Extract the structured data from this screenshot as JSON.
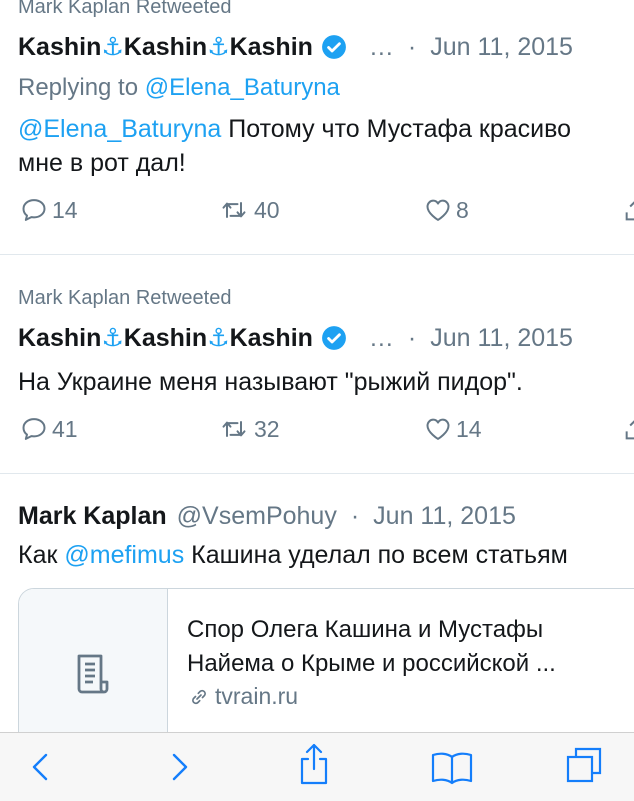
{
  "tweets": [
    {
      "retweeted_by": "Mark Kaplan Retweeted",
      "name_part1": "Kashin",
      "name_part2": "Kashin",
      "name_part3": "Kashin",
      "anchor_glyph": "⚓",
      "more": "…",
      "sep": "·",
      "date": "Jun 11, 2015",
      "replying_label": "Replying to",
      "replying_handle": "@Elena_Baturyna",
      "text_mention": "@Elena_Baturyna",
      "text": " Потому что Мустафа красиво мне в рот дал!",
      "replies": "14",
      "retweets": "40",
      "likes": "8"
    },
    {
      "retweeted_by": "Mark Kaplan Retweeted",
      "name_part1": "Kashin",
      "name_part2": "Kashin",
      "name_part3": "Kashin",
      "anchor_glyph": "⚓",
      "more": "…",
      "sep": "·",
      "date": "Jun 11, 2015",
      "text": "На Украине меня называют \"рыжий пидор\".",
      "replies": "41",
      "retweets": "32",
      "likes": "14"
    },
    {
      "name": "Mark Kaplan",
      "handle": "@VsemPohuy",
      "sep": "·",
      "date": "Jun 11, 2015",
      "text_prefix": "Как ",
      "text_mention": "@mefimus",
      "text_suffix": " Кашина уделал по всем статьям",
      "card": {
        "title": "Спор Олега Кашина и Мустафы Найема о Крыме и российской ...",
        "domain": "tvrain.ru",
        "thumb_icon": "document-icon",
        "link_icon": "link-icon"
      }
    }
  ],
  "icons": {
    "reply": "reply-icon",
    "retweet": "retweet-icon",
    "like": "heart-icon",
    "verified": "verified-badge-icon"
  },
  "toolbar": {
    "back": "back-arrow-icon",
    "forward": "forward-arrow-icon",
    "share": "share-icon",
    "bookmarks": "bookmarks-icon",
    "tabs": "tabs-icon"
  },
  "colors": {
    "accent": "#1da1f2",
    "muted": "#657786",
    "text": "#14171a",
    "divider": "#e1e8ed",
    "toolbar_icon": "#147efb"
  }
}
